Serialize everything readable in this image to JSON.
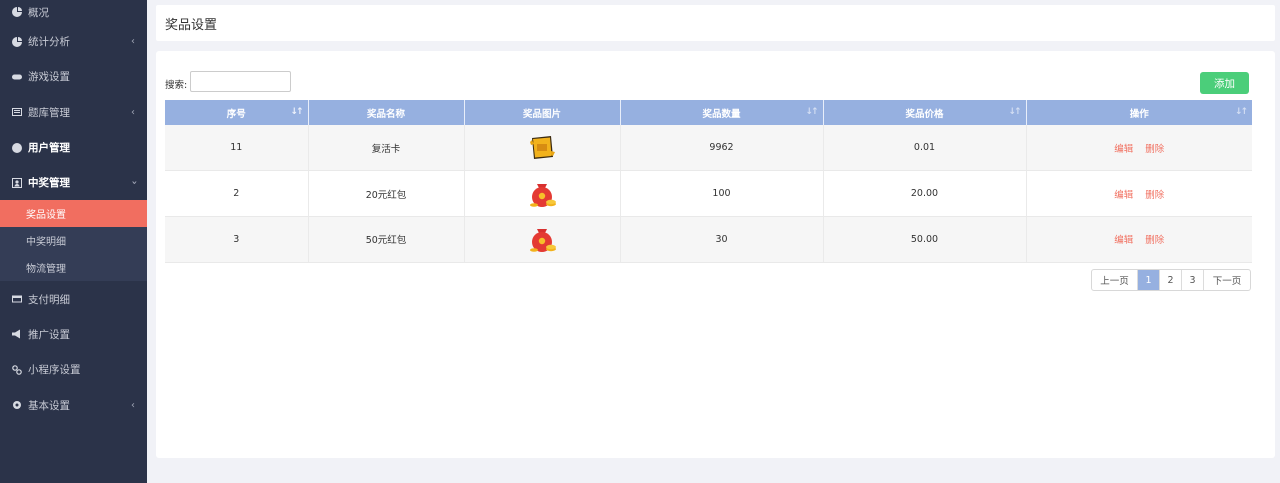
{
  "sidebar": {
    "items": [
      {
        "label": "概况",
        "icon": "pie-chart-icon"
      },
      {
        "label": "统计分析",
        "icon": "pie-chart-icon",
        "chevron": "‹"
      },
      {
        "label": "游戏设置",
        "icon": "gamepad-icon"
      },
      {
        "label": "题库管理",
        "icon": "list-icon",
        "chevron": "‹"
      },
      {
        "label": "用户管理",
        "icon": "user-icon"
      },
      {
        "label": "中奖管理",
        "icon": "portrait-icon",
        "chevron": "›"
      },
      {
        "label": "支付明细",
        "icon": "credit-card-icon"
      },
      {
        "label": "推广设置",
        "icon": "megaphone-icon"
      },
      {
        "label": "小程序设置",
        "icon": "link-icon"
      },
      {
        "label": "基本设置",
        "icon": "gear-icon",
        "chevron": "‹"
      }
    ],
    "subitems": [
      {
        "label": "奖品设置"
      },
      {
        "label": "中奖明细"
      },
      {
        "label": "物流管理"
      }
    ]
  },
  "header": {
    "title": "奖品设置"
  },
  "toolbar": {
    "search_label": "搜索:",
    "search_value": "",
    "add_label": "添加"
  },
  "table": {
    "columns": [
      "序号",
      "奖品名称",
      "奖品图片",
      "奖品数量",
      "奖品价格",
      "操作"
    ],
    "rows": [
      {
        "id": "11",
        "name": "复活卡",
        "image": "revive-card-icon",
        "qty": "9962",
        "price": "0.01"
      },
      {
        "id": "2",
        "name": "20元红包",
        "image": "red-bag-icon",
        "qty": "100",
        "price": "20.00"
      },
      {
        "id": "3",
        "name": "50元红包",
        "image": "red-bag-icon",
        "qty": "30",
        "price": "50.00"
      }
    ],
    "edit_label": "编辑",
    "delete_label": "删除"
  },
  "pager": {
    "prev": "上一页",
    "pages": [
      "1",
      "2",
      "3"
    ],
    "current": "1",
    "next": "下一页"
  },
  "colors": {
    "sidebar": "#2b3349",
    "active": "#f16e60",
    "header": "#96b0e0",
    "add": "#4bce7a"
  }
}
